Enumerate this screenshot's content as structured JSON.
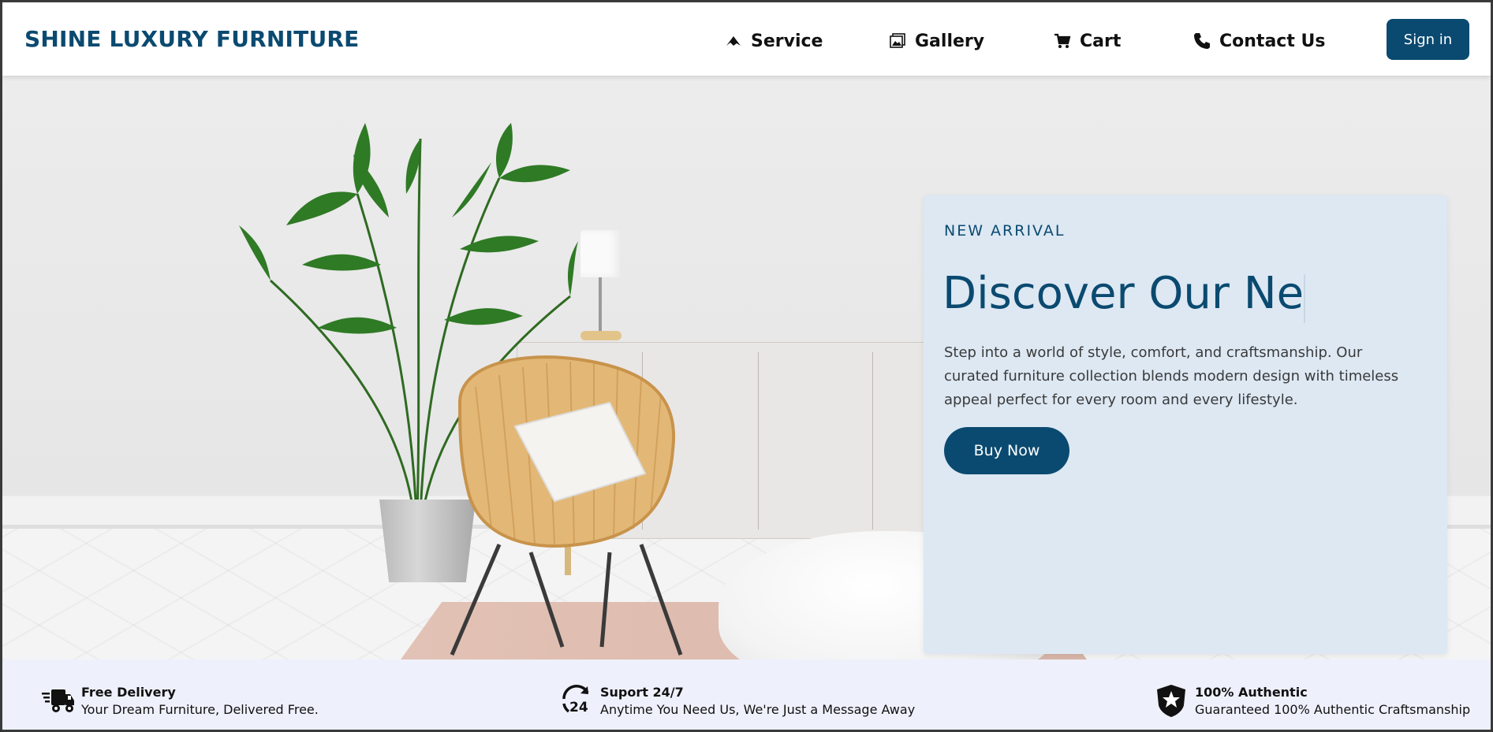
{
  "brand": "SHINE LUXURY FURNITURE",
  "nav": {
    "items": [
      {
        "label": "Service",
        "icon": "service-icon"
      },
      {
        "label": "Gallery",
        "icon": "gallery-icon"
      },
      {
        "label": "Cart",
        "icon": "cart-icon"
      },
      {
        "label": "Contact Us",
        "icon": "phone-icon"
      }
    ],
    "signin": "Sign in"
  },
  "hero": {
    "eyebrow": "NEW ARRIVAL",
    "headline": "Discover Our Ne",
    "description": "Step into a world of style, comfort, and craftsmanship. Our curated furniture collection blends modern design with timeless appeal perfect for every room and every lifestyle.",
    "cta": "Buy Now"
  },
  "features": [
    {
      "title": "Free Delivery",
      "subtitle": "Your Dream Furniture, Delivered Free.",
      "icon": "delivery-truck-icon"
    },
    {
      "title": "Suport 24/7",
      "subtitle": "Anytime You Need Us, We're Just a Message Away",
      "icon": "support-24-icon"
    },
    {
      "title": "100% Authentic",
      "subtitle": "Guaranteed 100% Authentic Craftsmanship",
      "icon": "authentic-badge-icon"
    }
  ],
  "colors": {
    "brand": "#0b4a70",
    "card_bg": "#dde8f3",
    "features_bg": "#eef1fc"
  }
}
